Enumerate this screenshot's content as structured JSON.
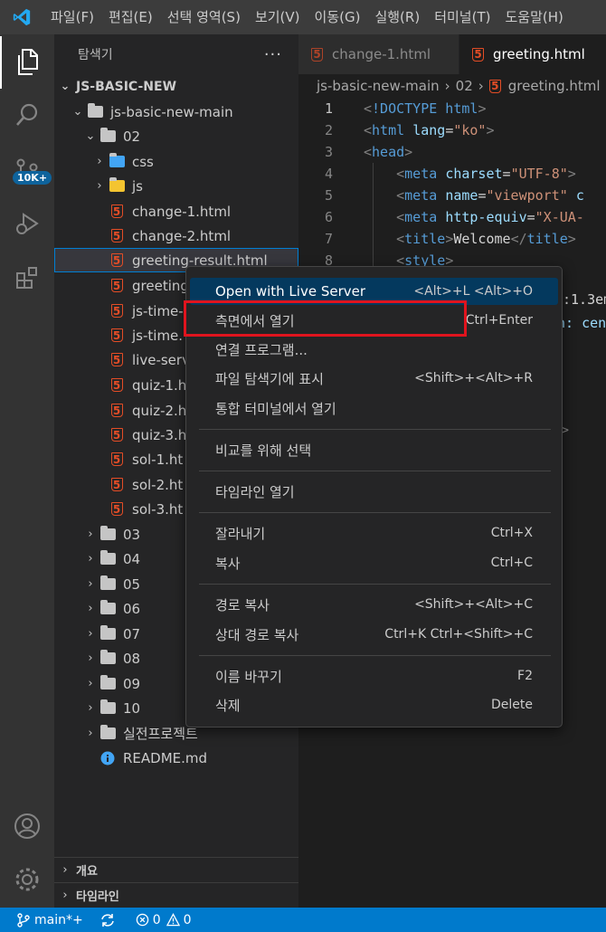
{
  "menubar": {
    "items": [
      "파일(F)",
      "편집(E)",
      "선택 영역(S)",
      "보기(V)",
      "이동(G)",
      "실행(R)",
      "터미널(T)",
      "도움말(H)"
    ]
  },
  "activity": {
    "badge": "10K+"
  },
  "explorer": {
    "title": "탐색기",
    "more": "···",
    "root": "JS-BASIC-NEW",
    "items": [
      "js-basic-new-main",
      "02",
      "css",
      "js",
      "change-1.html",
      "change-2.html",
      "greeting-result.html",
      "greeting",
      "js-time-",
      "js-time.",
      "live-serv",
      "quiz-1.h",
      "quiz-2.h",
      "quiz-3.h",
      "sol-1.ht",
      "sol-2.ht",
      "sol-3.ht",
      "03",
      "04",
      "05",
      "06",
      "07",
      "08",
      "09",
      "10",
      "실전프로젝트",
      "README.md"
    ],
    "panels": [
      "개요",
      "타임라인"
    ]
  },
  "editor": {
    "tabs": [
      "change-1.html",
      "greeting.html"
    ],
    "breadcrumb": [
      "js-basic-new-main",
      "02",
      "greeting.html"
    ],
    "line_numbers": [
      "1",
      "2",
      "3",
      "4",
      "5",
      "6",
      "7",
      "8"
    ],
    "code": {
      "l1": "!DOCTYPE html",
      "l2_tag": "html",
      "l2_attr": "lang",
      "l2_val": "\"ko\"",
      "l3_tag": "head",
      "l4_tag": "meta",
      "l4_attr": "charset",
      "l4_val": "\"UTF-8\"",
      "l5_tag": "meta",
      "l5_attr": "name",
      "l5_val": "\"viewport\"",
      "l5_more": "c",
      "l6_tag": "meta",
      "l6_attr": "http-equiv",
      "l6_val": "\"X-UA-",
      "l7_tag": "title",
      "l7_text": "Welcome",
      "l8_tag": "style",
      "peek1": ":1.3em",
      "peek2": "n: cen",
      "peek3": ">"
    }
  },
  "context_menu": {
    "items": [
      {
        "label": "Open with Live Server",
        "shortcut": "<Alt>+L <Alt>+O"
      },
      {
        "label": "측면에서 열기",
        "shortcut": "Ctrl+Enter"
      },
      {
        "label": "연결 프로그램...",
        "shortcut": ""
      },
      {
        "label": "파일 탐색기에 표시",
        "shortcut": "<Shift>+<Alt>+R"
      },
      {
        "label": "통합 터미널에서 열기",
        "shortcut": ""
      },
      {
        "label": "비교를 위해 선택",
        "shortcut": ""
      },
      {
        "label": "타임라인 열기",
        "shortcut": ""
      },
      {
        "label": "잘라내기",
        "shortcut": "Ctrl+X"
      },
      {
        "label": "복사",
        "shortcut": "Ctrl+C"
      },
      {
        "label": "경로 복사",
        "shortcut": "<Shift>+<Alt>+C"
      },
      {
        "label": "상대 경로 복사",
        "shortcut": "Ctrl+K Ctrl+<Shift>+C"
      },
      {
        "label": "이름 바꾸기",
        "shortcut": "F2"
      },
      {
        "label": "삭제",
        "shortcut": "Delete"
      }
    ]
  },
  "statusbar": {
    "branch": "main*+",
    "errors": "0",
    "warnings": "0"
  },
  "colors": {
    "accent": "#007acc",
    "html_icon": "#e44d26",
    "highlight_box": "#e0141e",
    "menu_highlight": "#04395e"
  }
}
